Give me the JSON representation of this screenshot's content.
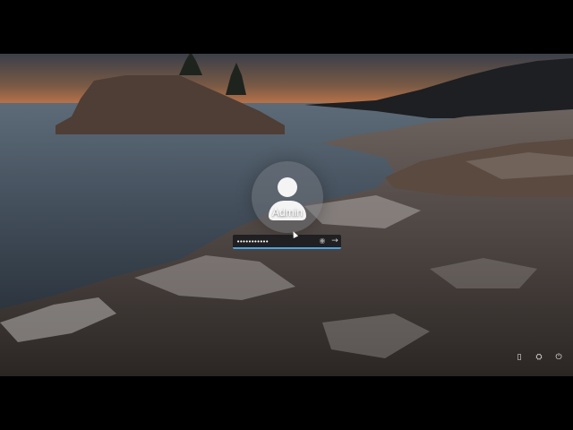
{
  "lock_screen": {
    "username": "Admin",
    "password": {
      "value": "•••••••••••",
      "reveal_icon": "eye-icon",
      "submit_icon": "arrow-right-icon"
    },
    "accent_color": "#4aa3df",
    "corner_icons": [
      {
        "icon": "network-icon",
        "glyph": "▯"
      },
      {
        "icon": "accessibility-icon",
        "glyph": "⛭"
      },
      {
        "icon": "power-icon",
        "glyph": "⏻"
      }
    ]
  }
}
